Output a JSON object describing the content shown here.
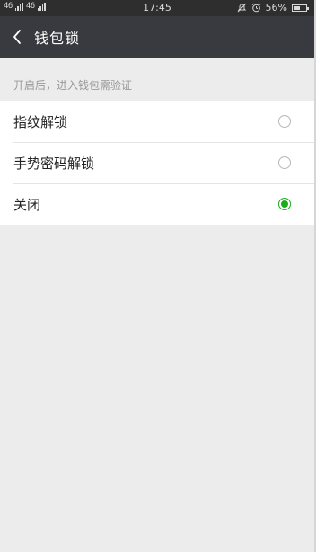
{
  "status_bar": {
    "left_text_1": "46",
    "left_text_2": "46",
    "time": "17:45",
    "battery": "56%",
    "battery_level": 0.56,
    "icons": [
      "network-sim-icon",
      "signal-icon",
      "silent-bell-icon",
      "alarm-icon",
      "battery-icon"
    ]
  },
  "nav": {
    "back_icon": "chevron-left-icon",
    "title": "钱包锁"
  },
  "section": {
    "hint": "开启后，进入钱包需验证"
  },
  "options": [
    {
      "label": "指纹解锁",
      "checked": false
    },
    {
      "label": "手势密码解锁",
      "checked": false
    },
    {
      "label": "关闭",
      "checked": true
    }
  ],
  "colors": {
    "nav_bg": "#393a3f",
    "accent": "#1aad19",
    "page_bg": "#ececec"
  }
}
